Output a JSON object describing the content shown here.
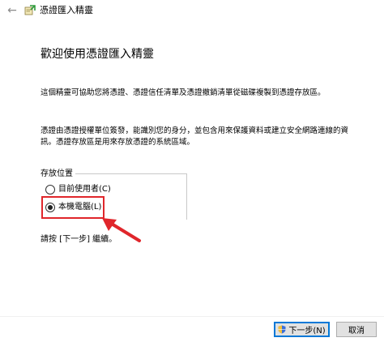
{
  "window": {
    "title": "憑證匯入精靈",
    "back_glyph": "←"
  },
  "main": {
    "heading": "歡迎使用憑證匯入精靈",
    "paragraph1": "這個精靈可協助您將憑證、憑證信任清單及憑證撤銷清單從磁碟複製到憑證存放區。",
    "paragraph2": "憑證由憑證授權單位簽發，能識別您的身分，並包含用來保護資料或建立安全網路連線的資訊。憑證存放區是用來存放憑證的系統區域。",
    "store_location": {
      "label": "存放位置",
      "options": [
        {
          "label": "目前使用者(C)",
          "selected": false
        },
        {
          "label": "本機電腦(L)",
          "selected": true
        }
      ]
    },
    "instruction": "請按 [下一步] 繼續。"
  },
  "footer": {
    "next_label": "下一步(N)",
    "cancel_label": "取消"
  },
  "colors": {
    "highlight": "#e0262b",
    "accent": "#0078d7"
  }
}
